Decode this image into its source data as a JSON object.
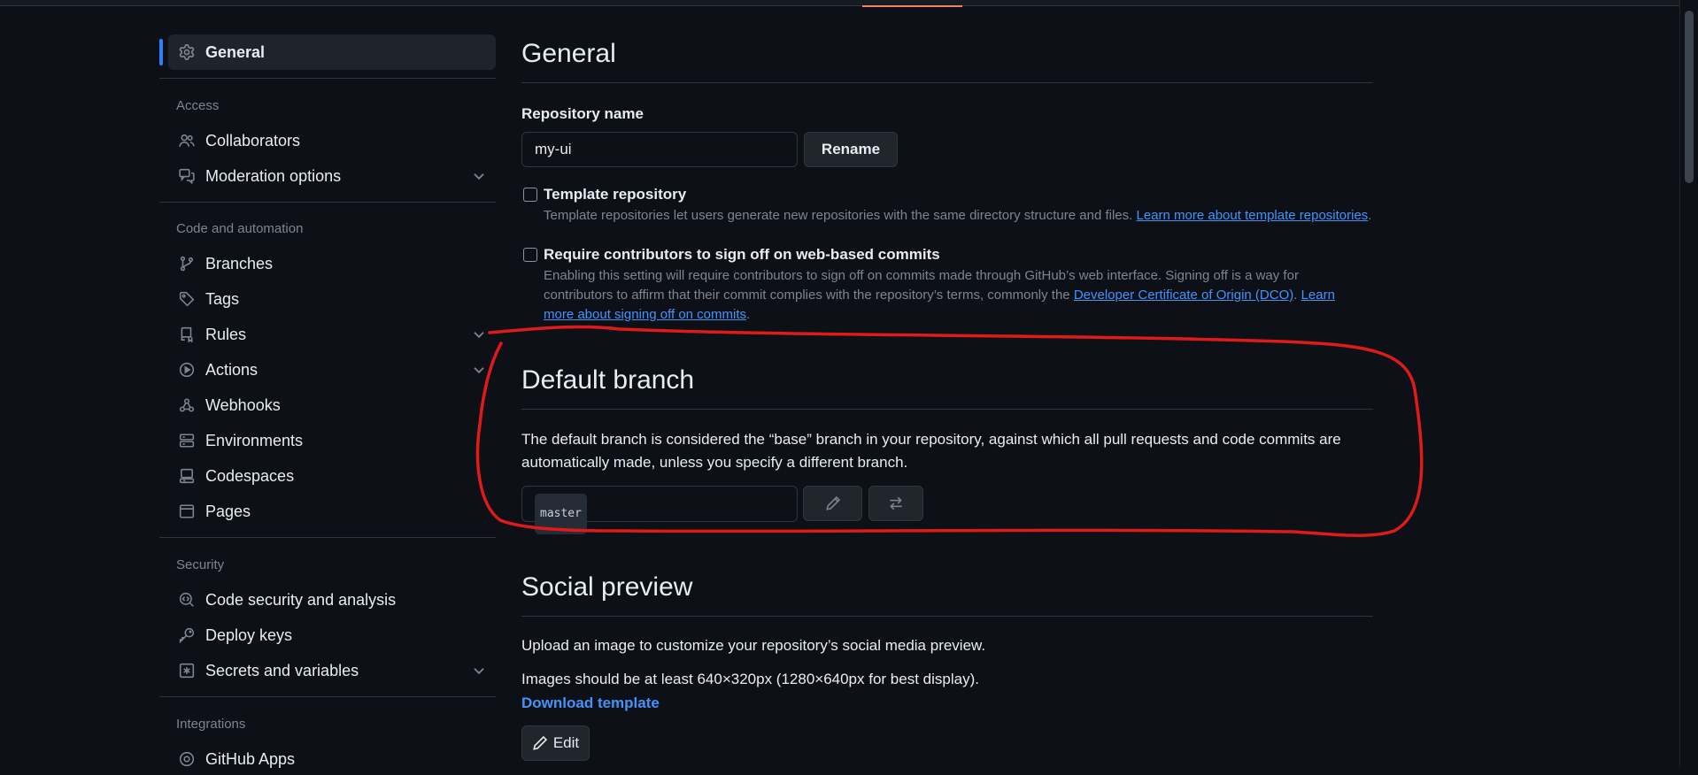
{
  "sidebar": {
    "general": {
      "label": "General",
      "icon": "gear-icon"
    },
    "access": {
      "heading": "Access",
      "items": [
        {
          "label": "Collaborators",
          "icon": "people-icon"
        },
        {
          "label": "Moderation options",
          "icon": "comment-discussion-icon",
          "expandable": true
        }
      ]
    },
    "code_automation": {
      "heading": "Code and automation",
      "items": [
        {
          "label": "Branches",
          "icon": "git-branch-icon"
        },
        {
          "label": "Tags",
          "icon": "tag-icon"
        },
        {
          "label": "Rules",
          "icon": "repo-push-icon",
          "expandable": true
        },
        {
          "label": "Actions",
          "icon": "play-icon",
          "expandable": true
        },
        {
          "label": "Webhooks",
          "icon": "webhook-icon"
        },
        {
          "label": "Environments",
          "icon": "server-icon"
        },
        {
          "label": "Codespaces",
          "icon": "codespaces-icon"
        },
        {
          "label": "Pages",
          "icon": "browser-icon"
        }
      ]
    },
    "security": {
      "heading": "Security",
      "items": [
        {
          "label": "Code security and analysis",
          "icon": "codescan-icon"
        },
        {
          "label": "Deploy keys",
          "icon": "key-icon"
        },
        {
          "label": "Secrets and variables",
          "icon": "asterisk-icon",
          "expandable": true
        }
      ]
    },
    "integrations": {
      "heading": "Integrations",
      "items": [
        {
          "label": "GitHub Apps",
          "icon": "apps-icon"
        }
      ]
    }
  },
  "main": {
    "general": {
      "title": "General",
      "repo_name_label": "Repository name",
      "repo_name_value": "my-ui",
      "rename_button": "Rename",
      "template": {
        "title": "Template repository",
        "desc": "Template repositories let users generate new repositories with the same directory structure and files.",
        "link": "Learn more about template repositories",
        "after": ".",
        "checked": false
      },
      "signoff": {
        "title": "Require contributors to sign off on web-based commits",
        "desc": "Enabling this setting will require contributors to sign off on commits made through GitHub’s web interface. Signing off is a way for contributors to affirm that their commit complies with the repository’s terms, commonly the",
        "link1": "Developer Certificate of Origin (DCO)",
        "mid": ".",
        "link2": "Learn more about signing off on commits",
        "after": ".",
        "checked": false
      }
    },
    "default_branch": {
      "title": "Default branch",
      "desc": "The default branch is considered the “base” branch in your repository, against which all pull requests and code commits are automatically made, unless you specify a different branch.",
      "branch": "master",
      "edit_icon": "pencil-icon",
      "switch_icon": "arrow-switch-icon"
    },
    "social_preview": {
      "title": "Social preview",
      "desc": "Upload an image to customize your repository’s social media preview.",
      "size_hint": "Images should be at least 640×320px (1280×640px for best display).",
      "download_link": "Download template",
      "edit_button": "Edit"
    }
  },
  "colors": {
    "background": "#0d1117",
    "accent_link": "#4493f8",
    "active_indicator": "#2f81f7",
    "annotation": "#e01a1a"
  }
}
